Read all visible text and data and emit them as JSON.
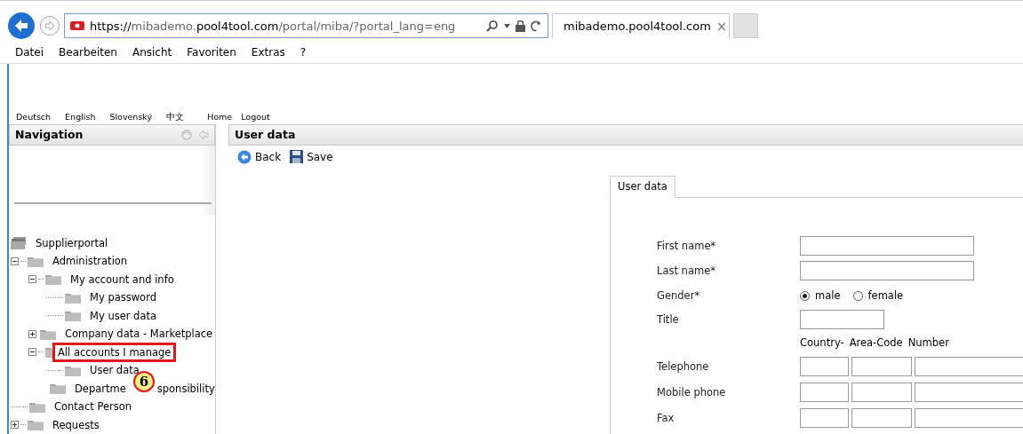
{
  "browser": {
    "url_scheme": "https://",
    "url_host_pre": "mibademo.",
    "url_host": "pool4tool.com",
    "url_path": "/portal/miba/?portal_lang=eng",
    "tab_title": "mibademo.pool4tool.com",
    "tab_close": "×",
    "menu": [
      "Datei",
      "Bearbeiten",
      "Ansicht",
      "Favoriten",
      "Extras",
      "?"
    ]
  },
  "top_links": [
    {
      "label": "Deutsch",
      "kind": "lang"
    },
    {
      "label": "English",
      "kind": "lang"
    },
    {
      "label": "Slovenský",
      "kind": "lang"
    },
    {
      "label": "中文",
      "kind": "lang"
    },
    {
      "label": "Home",
      "kind": "nav"
    },
    {
      "label": "Logout",
      "kind": "nav"
    }
  ],
  "navigation": {
    "title": "Navigation",
    "root": "Supplierportal",
    "tree": [
      {
        "label": "Administration",
        "expanded": true,
        "children": [
          {
            "label": "My account and info",
            "expanded": true,
            "children": [
              {
                "label": "My password"
              },
              {
                "label": "My user data"
              }
            ]
          },
          {
            "label": "Company data - Marketplace",
            "expanded": false
          },
          {
            "label": "All accounts I manage",
            "expanded": true,
            "highlighted": true,
            "children": [
              {
                "label": "User data"
              },
              {
                "label": "Departme",
                "label_tail": "sponsibility",
                "callout": "6"
              }
            ]
          }
        ]
      },
      {
        "label": "Contact Person"
      },
      {
        "label": "Requests",
        "expanded": false
      }
    ]
  },
  "main": {
    "title": "User data",
    "toolbar": [
      {
        "label": "Back",
        "kind": "back"
      },
      {
        "label": "Save",
        "kind": "save"
      }
    ],
    "tab": {
      "label": "User data",
      "selected": true
    },
    "fields": [
      {
        "kind": "text",
        "label": "First name*"
      },
      {
        "kind": "text",
        "label": "Last name*"
      },
      {
        "kind": "radio",
        "label": "Gender*",
        "options": [
          {
            "label": "male",
            "selected": true
          },
          {
            "label": "female",
            "selected": false
          }
        ]
      },
      {
        "kind": "short",
        "label": "Title"
      },
      {
        "kind": "headers",
        "columns": [
          "Country-",
          "Area-Code",
          "Number"
        ]
      },
      {
        "kind": "phone",
        "label": "Telephone"
      },
      {
        "kind": "phone",
        "label": "Mobile phone"
      },
      {
        "kind": "phone",
        "label": "Fax"
      }
    ]
  }
}
